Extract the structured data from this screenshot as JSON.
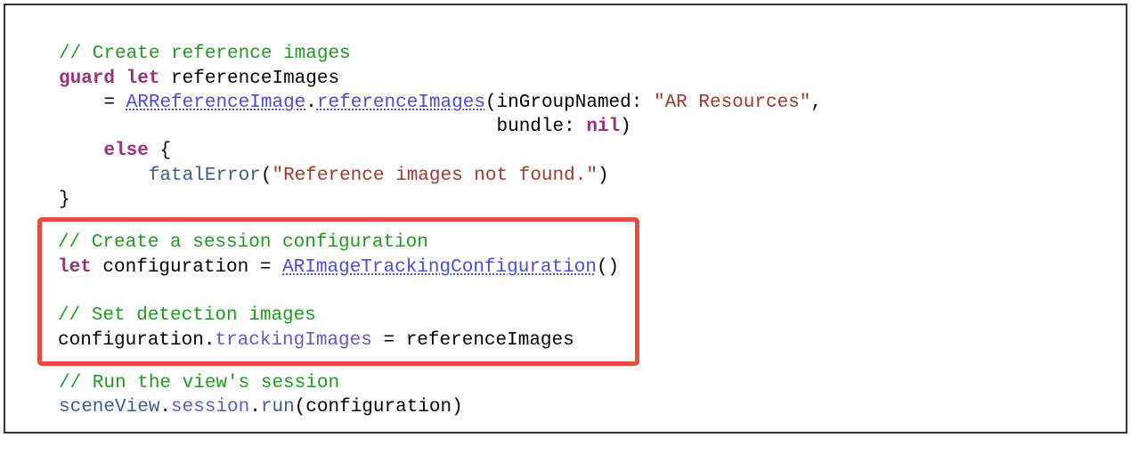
{
  "code": {
    "line1_comment": "// Create reference images",
    "line2_guard": "guard",
    "line2_let": "let",
    "line2_var": "referenceImages",
    "line3_eq": "=",
    "line3_type": "ARReferenceImage",
    "line3_dot": ".",
    "line3_method": "referenceImages",
    "line3_paren_open": "(",
    "line3_param1_label": "inGroupNamed:",
    "line3_param1_value": "\"AR Resources\"",
    "line3_comma": ",",
    "line4_param2_label": "bundle:",
    "line4_param2_value": "nil",
    "line4_paren_close": ")",
    "line5_else": "else",
    "line5_brace_open": "{",
    "line6_fatal": "fatalError",
    "line6_paren_open": "(",
    "line6_string": "\"Reference images not found.\"",
    "line6_paren_close": ")",
    "line7_brace_close": "}",
    "box_comment1": "// Create a session configuration",
    "box_let": "let",
    "box_var": "configuration",
    "box_eq": "=",
    "box_type": "ARImageTrackingConfiguration",
    "box_parens": "()",
    "box_comment2": "// Set detection images",
    "box_config": "configuration",
    "box_dot": ".",
    "box_prop": "trackingImages",
    "box_eq2": "=",
    "box_refimg": "referenceImages",
    "line_last_comment": "// Run the view's session",
    "line_last_scene": "sceneView",
    "line_last_dot1": ".",
    "line_last_session": "session",
    "line_last_dot2": ".",
    "line_last_run": "run",
    "line_last_paren_open": "(",
    "line_last_arg": "configuration",
    "line_last_paren_close": ")"
  }
}
